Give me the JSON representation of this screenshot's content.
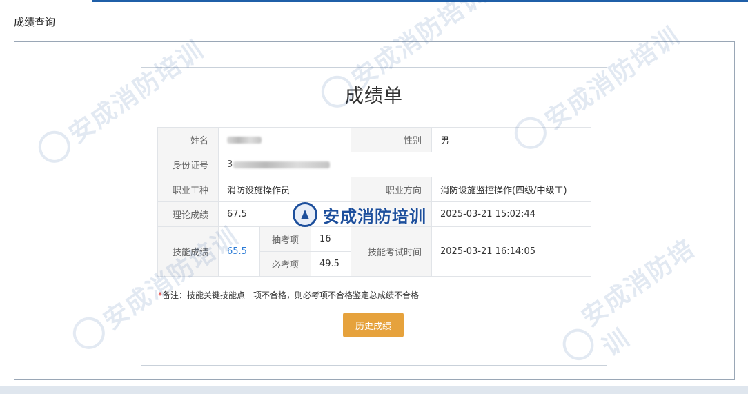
{
  "page": {
    "title": "成绩查询"
  },
  "report": {
    "title": "成绩单"
  },
  "table": {
    "name_label": "姓名",
    "gender_label": "性别",
    "gender_value": "男",
    "id_label": "身份证号",
    "id_value_visible": "3",
    "occupation_label": "职业工种",
    "occupation_value": "消防设施操作员",
    "direction_label": "职业方向",
    "direction_value": "消防设施监控操作(四级/中级工)",
    "theory_label": "理论成绩",
    "theory_value": "67.5",
    "theory_time_value": "2025-03-21 15:02:44",
    "skill_label": "技能成绩",
    "skill_value": "65.5",
    "draw_label": "抽考项",
    "draw_value": "16",
    "required_label": "必考项",
    "required_value": "49.5",
    "skill_time_label": "技能考试时间",
    "skill_time_value": "2025-03-21 16:14:05"
  },
  "remark": {
    "star": "*",
    "text": "备注：技能关键技能点一项不合格，则必考项不合格鉴定总成绩不合格"
  },
  "buttons": {
    "history": "历史成绩"
  },
  "watermark": {
    "text": "安成消防培训"
  },
  "colors": {
    "accent_top": "#1f5fa8",
    "link_blue": "#2b7bd6",
    "button_orange": "#e6a23c",
    "label_bg": "#f5f5f5",
    "remark_star": "#e53935",
    "brand_blue": "#1d4f9c"
  },
  "icons": {
    "brand_seal": "brand-seal-icon"
  }
}
